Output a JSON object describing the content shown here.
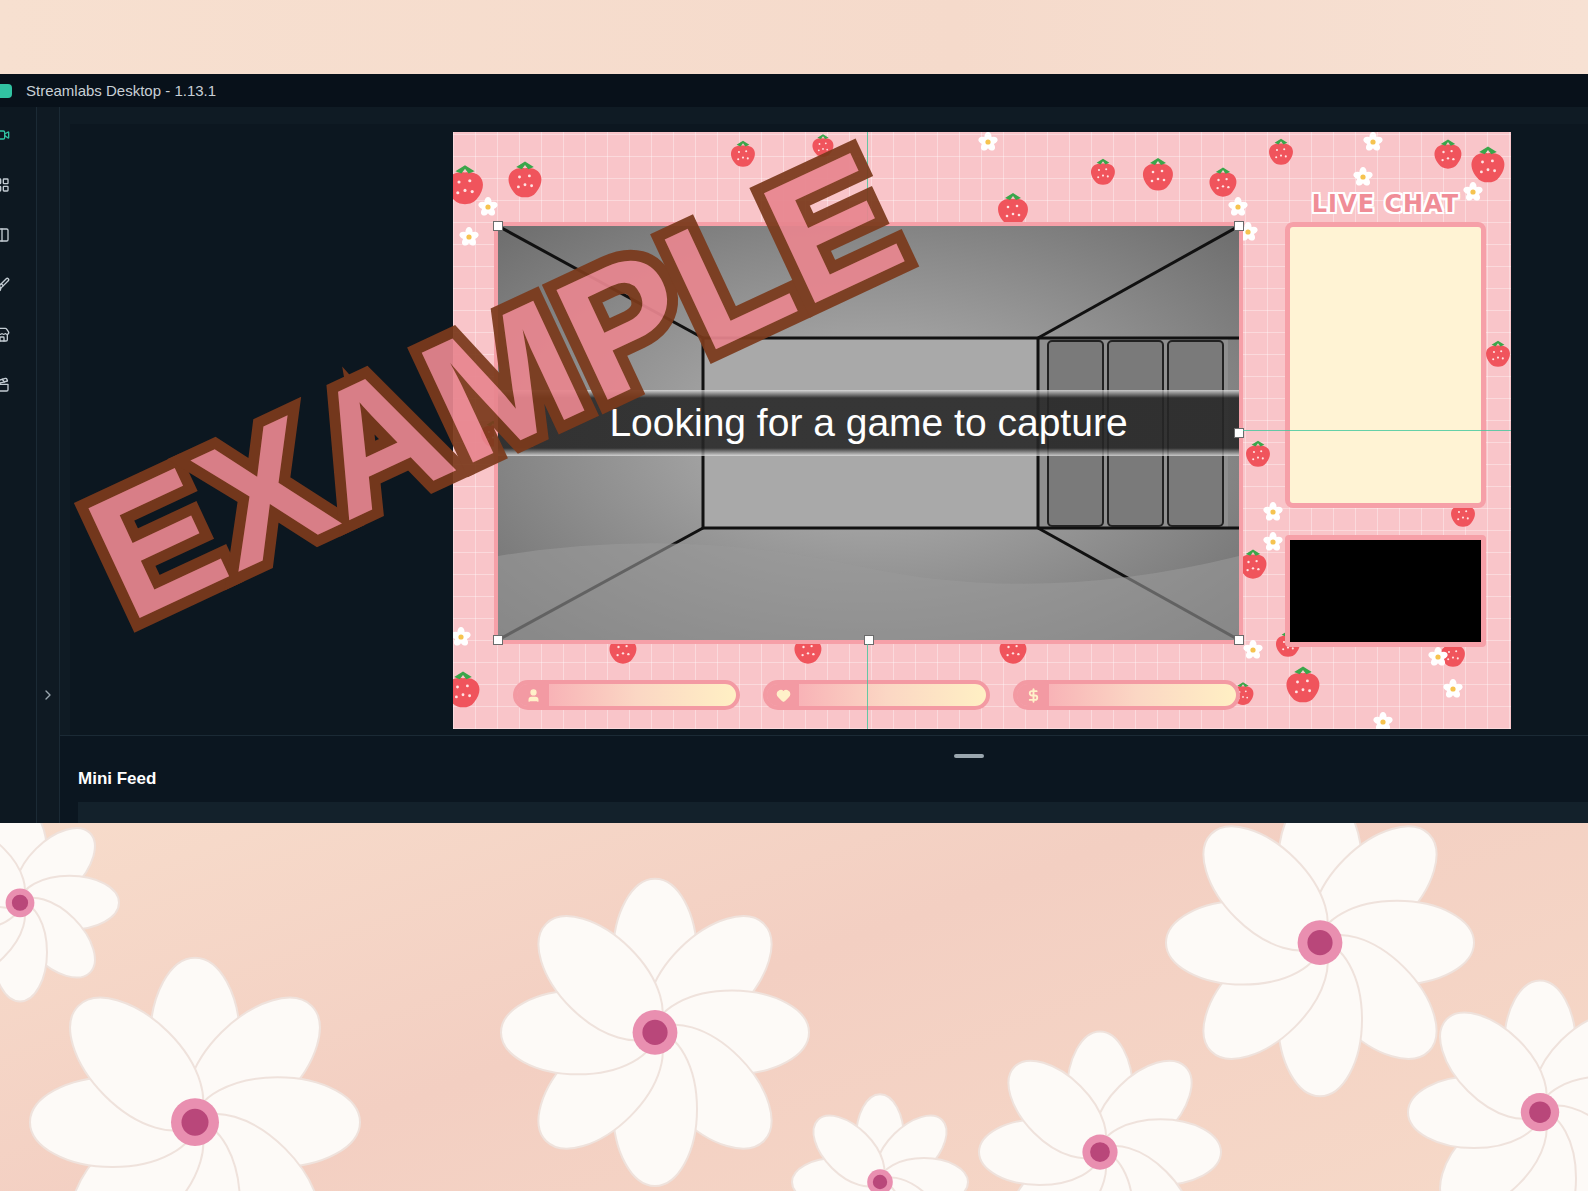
{
  "window": {
    "title": "Streamlabs Desktop - 1.13.1"
  },
  "watermark": {
    "text": "EXAMPLE"
  },
  "preview": {
    "capture": {
      "message": "Looking for a game to capture"
    },
    "chat": {
      "title": "LIVE CHAT"
    },
    "goal_bars": [
      {
        "kind": "follower"
      },
      {
        "kind": "heart"
      },
      {
        "kind": "dollar"
      }
    ]
  },
  "mini_feed": {
    "title": "Mini Feed"
  }
}
